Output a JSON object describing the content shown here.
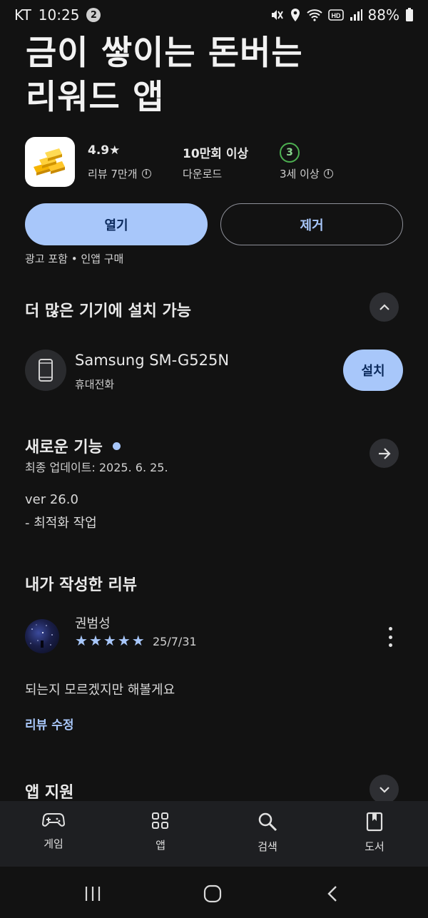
{
  "status_bar": {
    "carrier": "KT",
    "time": "10:25",
    "notification_count": "2",
    "battery": "88%"
  },
  "app": {
    "title_line1": "금이 쌓이는 돈버는",
    "title_line2": "리워드 앱",
    "rating": "4.9★",
    "reviews": "리뷰 7만개",
    "downloads": "10만회 이상",
    "downloads_label": "다운로드",
    "age_badge": "3",
    "age_label": "3세 이상"
  },
  "actions": {
    "open_label": "열기",
    "remove_label": "제거",
    "ads_note": "광고 포함 • 인앱 구매"
  },
  "devices_section": {
    "title": "더 많은 기기에 설치 가능",
    "device_name": "Samsung SM-G525N",
    "device_type": "휴대전화",
    "install_label": "설치"
  },
  "whats_new": {
    "title": "새로운 기능",
    "updated": "최종 업데이트: 2025. 6. 25.",
    "version": "ver 26.0",
    "notes": "- 최적화 작업"
  },
  "my_review": {
    "section_title": "내가 작성한 리뷰",
    "author": "권범성",
    "rating": 5,
    "date": "25/7/31",
    "text": "되는지 모르겠지만 해볼게요",
    "edit_label": "리뷰 수정"
  },
  "app_support": {
    "title": "앱 지원"
  },
  "bottom_nav": {
    "games": "게임",
    "apps": "앱",
    "search": "검색",
    "books": "도서"
  },
  "colors": {
    "accent": "#a8c7fa",
    "background": "#121212",
    "age_green": "#4caf50"
  }
}
